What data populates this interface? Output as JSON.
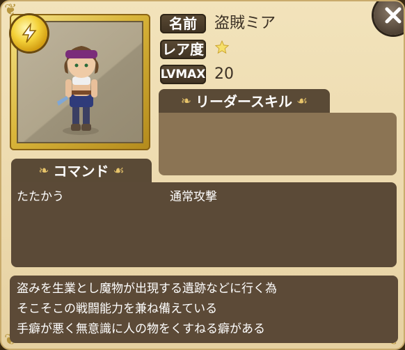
{
  "character": {
    "name_label": "名前",
    "name": "盗賊ミア",
    "rarity_label": "レア度",
    "rarity_stars": 1,
    "lv_label": "LVMAX",
    "lv_max": "20"
  },
  "leader_skill": {
    "tab_label": "リーダースキル",
    "text": ""
  },
  "command": {
    "tab_label": "コマンド",
    "rows": [
      {
        "name": "たたかう",
        "effect": "通常攻撃"
      }
    ]
  },
  "description": {
    "lines": [
      "盗みを生業とし魔物が出現する遺跡などに行く為",
      "そこそこの戦闘能力を兼ね備えている",
      "手癖が悪く無意識に人の物をくすねる癖がある"
    ]
  },
  "icons": {
    "element": "lightning-icon",
    "close": "close-icon",
    "star": "star-icon"
  },
  "colors": {
    "panel_bg": "#ecd9ad",
    "badge_bg": "#4a3b2a",
    "box_bg": "#5b4a37",
    "accent_gold": "#e7c46a"
  }
}
